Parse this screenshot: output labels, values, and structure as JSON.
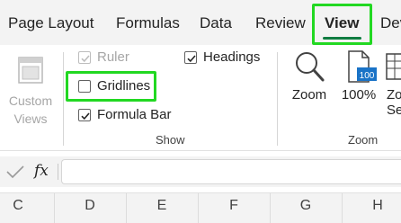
{
  "tabs": [
    {
      "id": "page-layout",
      "label": "Page Layout"
    },
    {
      "id": "formulas",
      "label": "Formulas"
    },
    {
      "id": "data",
      "label": "Data"
    },
    {
      "id": "review",
      "label": "Review"
    },
    {
      "id": "view",
      "label": "View",
      "active": true
    },
    {
      "id": "developer",
      "label": "Dev"
    }
  ],
  "workbook_views": {
    "custom_views_label": "Custom Views",
    "custom_views_icon": "custom-views-icon"
  },
  "show": {
    "group_label": "Show",
    "ruler": {
      "label": "Ruler",
      "checked": true,
      "disabled": true
    },
    "gridlines": {
      "label": "Gridlines",
      "checked": false
    },
    "formula_bar": {
      "label": "Formula Bar",
      "checked": true
    },
    "headings": {
      "label": "Headings",
      "checked": true
    }
  },
  "zoom": {
    "group_label": "Zoom",
    "zoom_label": "Zoom",
    "zoom_icon": "magnifier-icon",
    "hundred_label": "100%",
    "hundred_icon_text": "100",
    "selection_label_line1": "Zo",
    "selection_label_line2": "Se"
  },
  "formula_bar": {
    "cancel_icon": "checkmark-icon",
    "fx_label": "fx",
    "value": ""
  },
  "columns": [
    "C",
    "D",
    "E",
    "F",
    "G",
    "H"
  ],
  "colors": {
    "accent": "#107c41",
    "highlight": "#22d822",
    "disabled_text": "#a6a6a6",
    "excel_blue": "#1a73c7"
  }
}
